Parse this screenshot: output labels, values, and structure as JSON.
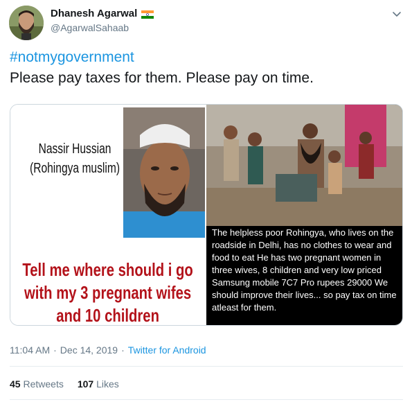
{
  "user": {
    "display_name": "Dhanesh Agarwal",
    "handle": "@AgarwalSahaab",
    "flag_icon": "india-flag-icon"
  },
  "tweet": {
    "hashtag": "#notmygovernment",
    "text": "Please pay taxes for them. Please pay on time."
  },
  "media": {
    "left_name": "Nassir Hussian (Rohingya muslim)",
    "left_quote": "Tell me where should i go with my 3 pregnant wifes and 10 children",
    "right_caption": "The helpless poor Rohingya, who lives on the roadside in Delhi, has no clothes to wear and food to eat  He has two pregnant women in three wives, 8 children and very low priced Samsung mobile 7C7 Pro rupees 29000 We should improve their lives... so pay tax on time atleast for them."
  },
  "meta": {
    "time": "11:04 AM",
    "separator": "·",
    "date": "Dec 14, 2019",
    "source": "Twitter for Android"
  },
  "stats": {
    "retweets_count": "45",
    "retweets_label": "Retweets",
    "likes_count": "107",
    "likes_label": "Likes"
  },
  "colors": {
    "link": "#1b95e0",
    "muted": "#657786",
    "text": "#14171a",
    "quote_red": "#b3121a"
  }
}
